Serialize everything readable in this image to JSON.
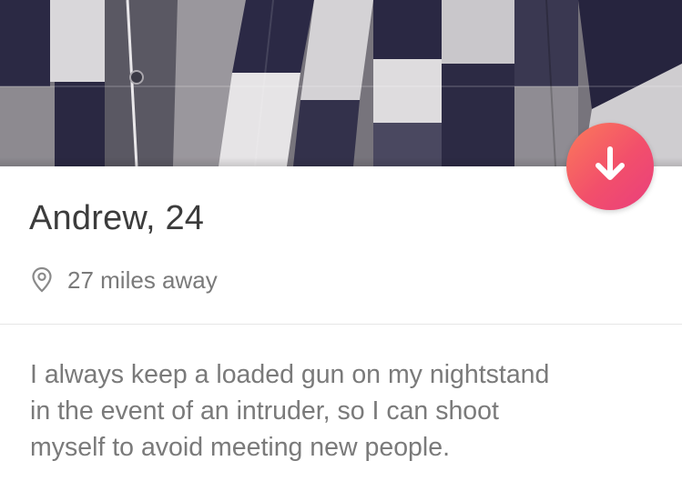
{
  "profile": {
    "photo_alt": "plaid shirt",
    "name_age": "Andrew, 24",
    "distance": "27 miles away",
    "bio_lines": [
      "I always keep a loaded gun on my nightstand",
      "in the event of an intruder, so I can shoot",
      "myself to avoid meeting new people."
    ]
  },
  "icons": {
    "collapse": "arrow-down-icon",
    "location": "location-pin-icon"
  },
  "colors": {
    "accent_start": "#fb7a5a",
    "accent_end": "#e93f7d",
    "name_text": "#3c3c3c",
    "secondary_text": "#7a7a7a"
  }
}
